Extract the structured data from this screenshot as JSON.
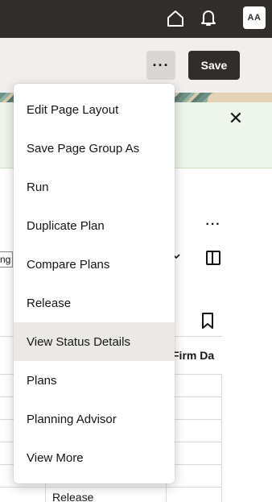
{
  "header": {
    "user_initials": "AA",
    "home_icon": "home-icon",
    "notifications_icon": "bell-icon"
  },
  "toolbar": {
    "more_label": "···",
    "save_label": "Save"
  },
  "content": {
    "more_label": "···",
    "input_fragment": "ng",
    "table_column_header": "Firm Da",
    "release_cell": "Release"
  },
  "menu": {
    "items": [
      {
        "label": "Edit Page Layout"
      },
      {
        "label": "Save Page Group As"
      },
      {
        "label": "Run"
      },
      {
        "label": "Duplicate Plan"
      },
      {
        "label": "Compare Plans"
      },
      {
        "label": "Release"
      },
      {
        "label": "View Status Details"
      },
      {
        "label": "Plans"
      },
      {
        "label": "Planning Advisor"
      },
      {
        "label": "View More"
      }
    ],
    "hovered_index": 6
  },
  "colors": {
    "topbar": "#312d2a",
    "menu_hover": "#ebe9e6",
    "message_bg": "#eef5ea"
  }
}
